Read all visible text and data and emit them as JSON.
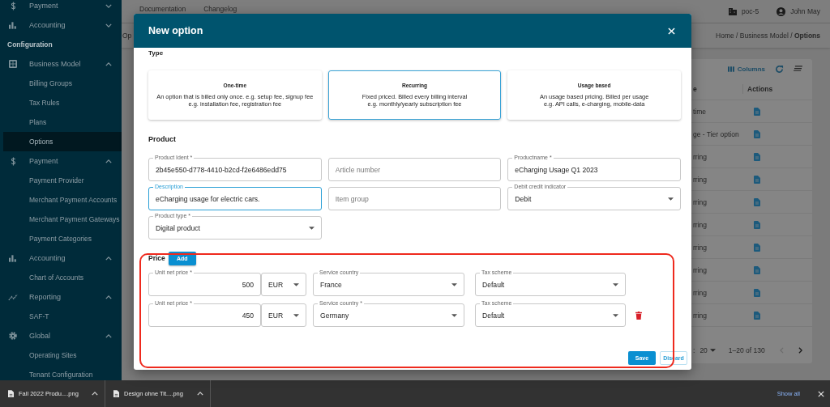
{
  "sidebar": {
    "items": [
      {
        "kind": "group",
        "label": "Payment",
        "expanded": false
      },
      {
        "kind": "group",
        "label": "Accounting",
        "expanded": false
      },
      {
        "kind": "heading",
        "label": "Configuration"
      },
      {
        "kind": "group",
        "label": "Business Model",
        "expanded": true,
        "children": [
          {
            "label": "Billing Groups",
            "selected": false
          },
          {
            "label": "Tax Rules",
            "selected": false
          },
          {
            "label": "Plans",
            "selected": false
          },
          {
            "label": "Options",
            "selected": true
          }
        ]
      },
      {
        "kind": "group",
        "label": "Payment",
        "expanded": true,
        "children": [
          {
            "label": "Payment Provider",
            "selected": false
          },
          {
            "label": "Merchant Payment Accounts",
            "selected": false
          },
          {
            "label": "Merchant Payment Gateways",
            "selected": false
          },
          {
            "label": "Payment Categories",
            "selected": false
          }
        ]
      },
      {
        "kind": "group",
        "label": "Accounting",
        "expanded": true,
        "children": [
          {
            "label": "Chart of Accounts",
            "selected": false
          }
        ]
      },
      {
        "kind": "group",
        "label": "Reporting",
        "expanded": true,
        "children": [
          {
            "label": "SAF-T",
            "selected": false
          }
        ]
      },
      {
        "kind": "group",
        "label": "Global",
        "expanded": true,
        "children": [
          {
            "label": "Operating Sites",
            "selected": false
          },
          {
            "label": "Tenant Configuration",
            "selected": false
          }
        ]
      }
    ]
  },
  "header": {
    "links": [
      "Documentation",
      "Changelog"
    ],
    "workspace": "poc-5",
    "user": "John May",
    "page_tab": "Op",
    "breadcrumb": "Home / Business Model / **Options**"
  },
  "table": {
    "columns_button": "Columns",
    "columns": [
      "e",
      "Actions"
    ],
    "rows": [
      {
        "cells": [
          "time"
        ]
      },
      {
        "cells": [
          "ge - Tier option"
        ]
      },
      {
        "cells": [
          "rring"
        ]
      },
      {
        "cells": [
          "rring"
        ]
      },
      {
        "cells": [
          "rring"
        ]
      },
      {
        "cells": [
          "rring"
        ]
      },
      {
        "cells": [
          "rring"
        ]
      },
      {
        "cells": [
          "rring"
        ]
      },
      {
        "cells": [
          "rring"
        ]
      },
      {
        "cells": [
          "rring"
        ]
      }
    ],
    "rows_label": ":",
    "rows_per_page": "20",
    "range": "1–20 of 130"
  },
  "dialog": {
    "title": "New option",
    "type_label": "Type",
    "option_types": [
      {
        "title": "One-time",
        "description": [
          "An option that is billed only once. e.g. setup fee, signup fee",
          "e.g. installation fee, registration fee"
        ],
        "selected": false
      },
      {
        "title": "Recurring",
        "description": [
          "Fixed priced. Billed every billing interval",
          "e.g. monthly/yearly subscription fee"
        ],
        "selected": true
      },
      {
        "title": "Usage based",
        "description": [
          "An usage based pricing. Billed per usage",
          "e.g. API calls, e-charging, mobile-data"
        ],
        "selected": false
      }
    ],
    "product_heading": "Product",
    "product_fields": [
      {
        "kind": "text",
        "label": "Product Ident *",
        "value": "2b45e550-d778-4410-b2cd-f2e6486edd75",
        "focused": false
      },
      {
        "kind": "text",
        "placeholder": "Article number",
        "focused": false
      },
      {
        "kind": "text",
        "label": "Productname *",
        "value": "eCharging Usage Q1 2023",
        "focused": false
      },
      {
        "kind": "text",
        "label": "Description",
        "value": "eCharging usage for electric cars.",
        "focused": true
      },
      {
        "kind": "text",
        "placeholder": "Item group",
        "focused": false
      },
      {
        "kind": "select",
        "label": "Debit credit indicator",
        "value": "Debit",
        "focused": false
      },
      {
        "kind": "select",
        "label": "Product type *",
        "value": "Digital product",
        "focused": false
      }
    ],
    "price_heading": "Price",
    "add_button": "Add",
    "prices": [
      {
        "amount_label": "Unit net price *",
        "amount": "500",
        "currency": "EUR",
        "country_label": "Service country",
        "country": "France",
        "tax_label": "Tax scheme",
        "tax": "Default",
        "deletable": false
      },
      {
        "amount_label": "Unit net price *",
        "amount": "450",
        "currency": "EUR",
        "country_label": "Service country *",
        "country": "Germany",
        "tax_label": "Tax scheme",
        "tax": "Default",
        "deletable": true
      }
    ],
    "save_button": "Save",
    "discard_button": "Discard"
  },
  "downloads": {
    "files": [
      {
        "name": "Fall 2022 Produ....png"
      },
      {
        "name": "Design ohne Tit....png"
      }
    ],
    "show_all": "Show all"
  }
}
